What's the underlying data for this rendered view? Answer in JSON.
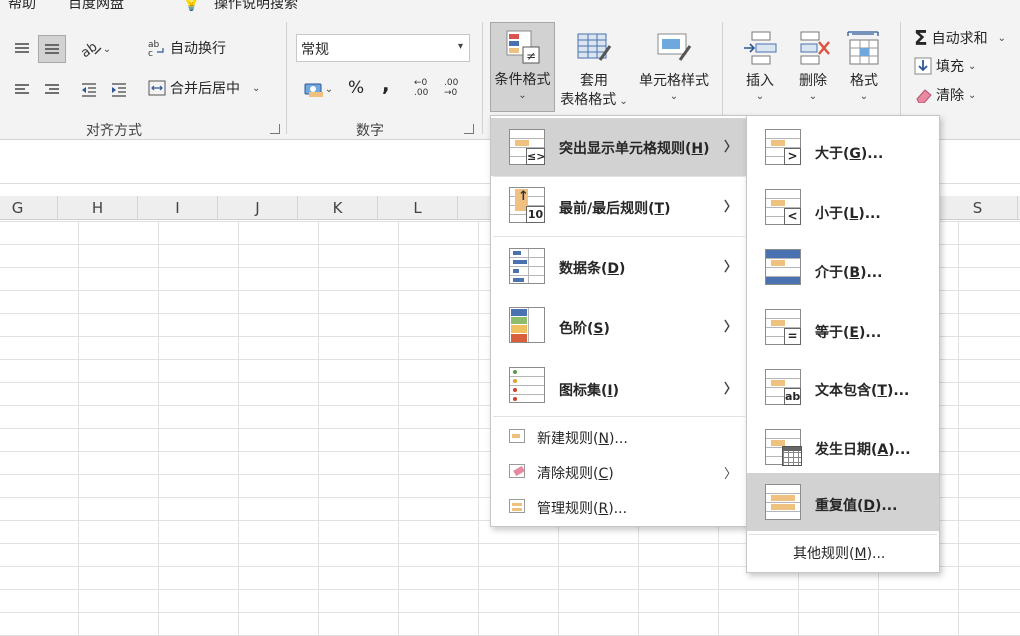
{
  "ribbon": {
    "tabs": [
      "帮助",
      "百度网盘",
      "操作说明搜索"
    ],
    "alignment": {
      "wrap_text": "自动换行",
      "merge_center": "合并后居中",
      "group_label": "对齐方式"
    },
    "number": {
      "format_value": "常规",
      "percent": "%",
      "comma": ",",
      "inc_decimal_top": "←0",
      "inc_decimal_bottom": ".00",
      "dec_decimal_top": ".00",
      "dec_decimal_bottom": "→0",
      "group_label": "数字"
    },
    "styles": {
      "conditional_format": "条件格式",
      "table_format_line1": "套用",
      "table_format_line2": "表格格式",
      "cell_styles": "单元格样式"
    },
    "cells": {
      "insert": "插入",
      "delete": "删除",
      "format": "格式"
    },
    "editing": {
      "autosum": "自动求和",
      "fill": "填充",
      "clear": "清除",
      "sigma": "Σ"
    }
  },
  "columns": [
    "G",
    "H",
    "I",
    "J",
    "K",
    "L",
    "S"
  ],
  "menu": {
    "items": [
      {
        "text": "突出显示单元格规则",
        "key": "H"
      },
      {
        "text": "最前/最后规则",
        "key": "T"
      },
      {
        "text": "数据条",
        "key": "D"
      },
      {
        "text": "色阶",
        "key": "S"
      },
      {
        "text": "图标集",
        "key": "I"
      }
    ],
    "small_items": [
      {
        "text": "新建规则",
        "key": "N",
        "suffix": "..."
      },
      {
        "text": "清除规则",
        "key": "C",
        "suffix": ""
      },
      {
        "text": "管理规则",
        "key": "R",
        "suffix": "..."
      }
    ],
    "top10_badge": "10"
  },
  "submenu": {
    "items": [
      {
        "text": "大于",
        "key": "G",
        "badge": ">"
      },
      {
        "text": "小于",
        "key": "L",
        "badge": "<"
      },
      {
        "text": "介于",
        "key": "B",
        "badge": ""
      },
      {
        "text": "等于",
        "key": "E",
        "badge": "="
      },
      {
        "text": "文本包含",
        "key": "T",
        "badge": "ab"
      },
      {
        "text": "发生日期",
        "key": "A",
        "badge": ""
      },
      {
        "text": "重复值",
        "key": "D",
        "badge": ""
      }
    ],
    "more_rules": {
      "text": "其他规则",
      "key": "M"
    }
  },
  "colors": {
    "highlight": "#d2d2d2",
    "accent_orange": "#f0c080",
    "accent_blue": "#4a72b0",
    "delete_red": "#e05040"
  }
}
